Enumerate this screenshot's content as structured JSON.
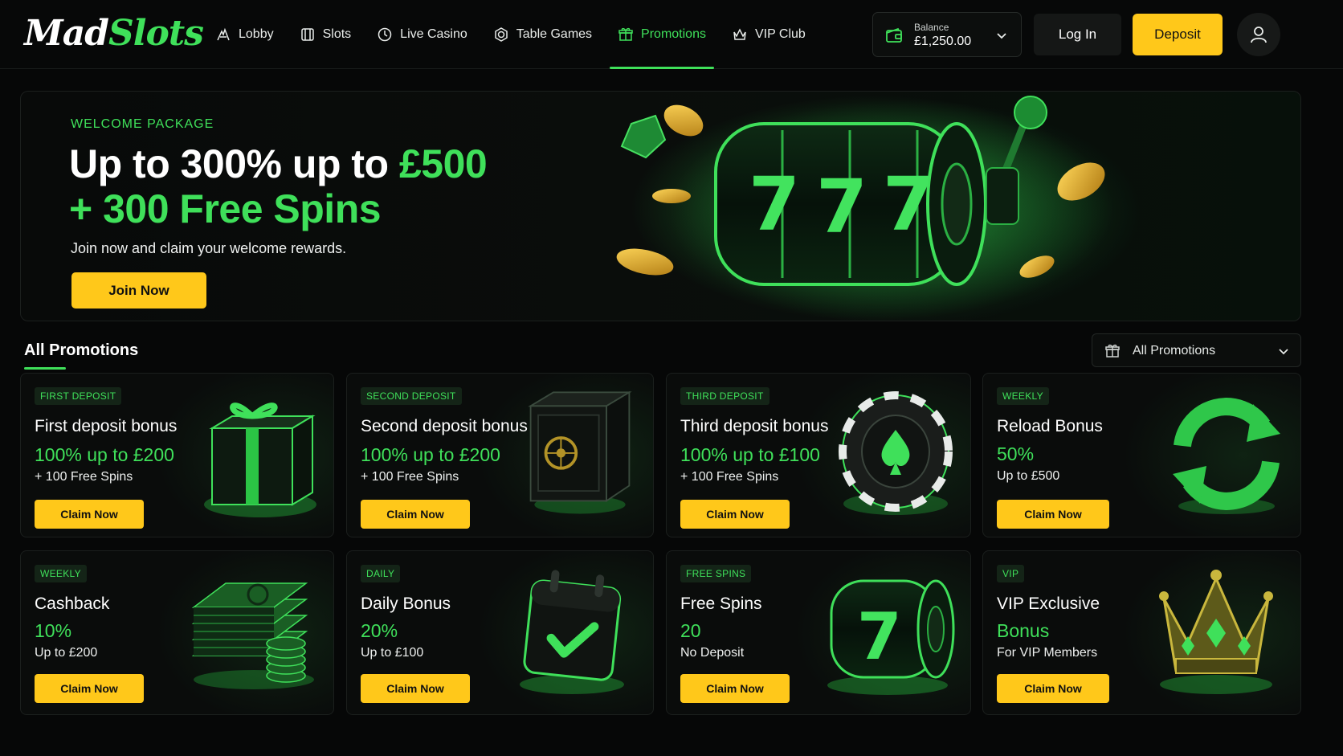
{
  "brand": {
    "name_part1": "Mad",
    "name_part2": "Slots"
  },
  "nav": {
    "items": [
      {
        "label": "Lobby",
        "icon": "lobby-icon"
      },
      {
        "label": "Slots",
        "icon": "slots-icon"
      },
      {
        "label": "Live Casino",
        "icon": "live-casino-icon"
      },
      {
        "label": "Table Games",
        "icon": "chip-icon"
      },
      {
        "label": "Promotions",
        "icon": "gift-icon",
        "active": true
      },
      {
        "label": "VIP Club",
        "icon": "crown-icon"
      }
    ]
  },
  "balance": {
    "label": "Balance",
    "value": "£1,250.00"
  },
  "header_actions": {
    "login_label": "Log In",
    "deposit_label": "Deposit"
  },
  "hero": {
    "eyebrow": "WELCOME PACKAGE",
    "headline_white": "Up to 300% up to ",
    "headline_green": "£500",
    "headline_line2": "+ 300 Free Spins",
    "subline": "Join now and claim your welcome rewards.",
    "cta_label": "Join Now",
    "reel_symbols": [
      "7",
      "7",
      "7"
    ]
  },
  "promotions": {
    "section_title": "All Promotions",
    "filter_label": "All Promotions",
    "cards": [
      {
        "tag": "FIRST DEPOSIT",
        "title": "First deposit bonus",
        "value": "100% up to £200",
        "detail": "+ 100 Free Spins",
        "cta": "Claim Now",
        "art": "gift-box"
      },
      {
        "tag": "SECOND DEPOSIT",
        "title": "Second deposit bonus",
        "value": "100% up to £200",
        "detail": "+ 100 Free Spins",
        "cta": "Claim Now",
        "art": "safe"
      },
      {
        "tag": "THIRD DEPOSIT",
        "title": "Third deposit bonus",
        "value": "100% up to £100",
        "detail": "+ 100 Free Spins",
        "cta": "Claim Now",
        "art": "poker-chip"
      },
      {
        "tag": "WEEKLY",
        "title": "Reload Bonus",
        "value": "50%",
        "detail": "Up to £500",
        "cta": "Claim Now",
        "art": "reload-arrows"
      },
      {
        "tag": "WEEKLY",
        "title": "Cashback",
        "value": "10%",
        "detail": "Up to £200",
        "cta": "Claim Now",
        "art": "cash-stack"
      },
      {
        "tag": "DAILY",
        "title": "Daily Bonus",
        "value": "20%",
        "detail": "Up to £100",
        "cta": "Claim Now",
        "art": "calendar-check"
      },
      {
        "tag": "FREE SPINS",
        "title": "Free Spins",
        "value": "20",
        "detail": "No Deposit",
        "cta": "Claim Now",
        "art": "slot-reel"
      },
      {
        "tag": "VIP",
        "title": "VIP Exclusive",
        "value": "Bonus",
        "detail": "For VIP Members",
        "cta": "Claim Now",
        "art": "crown"
      }
    ]
  },
  "colors": {
    "accent": "#3fe05a",
    "cta": "#ffc81a",
    "background": "#060707",
    "card": "#0a0c0b"
  }
}
